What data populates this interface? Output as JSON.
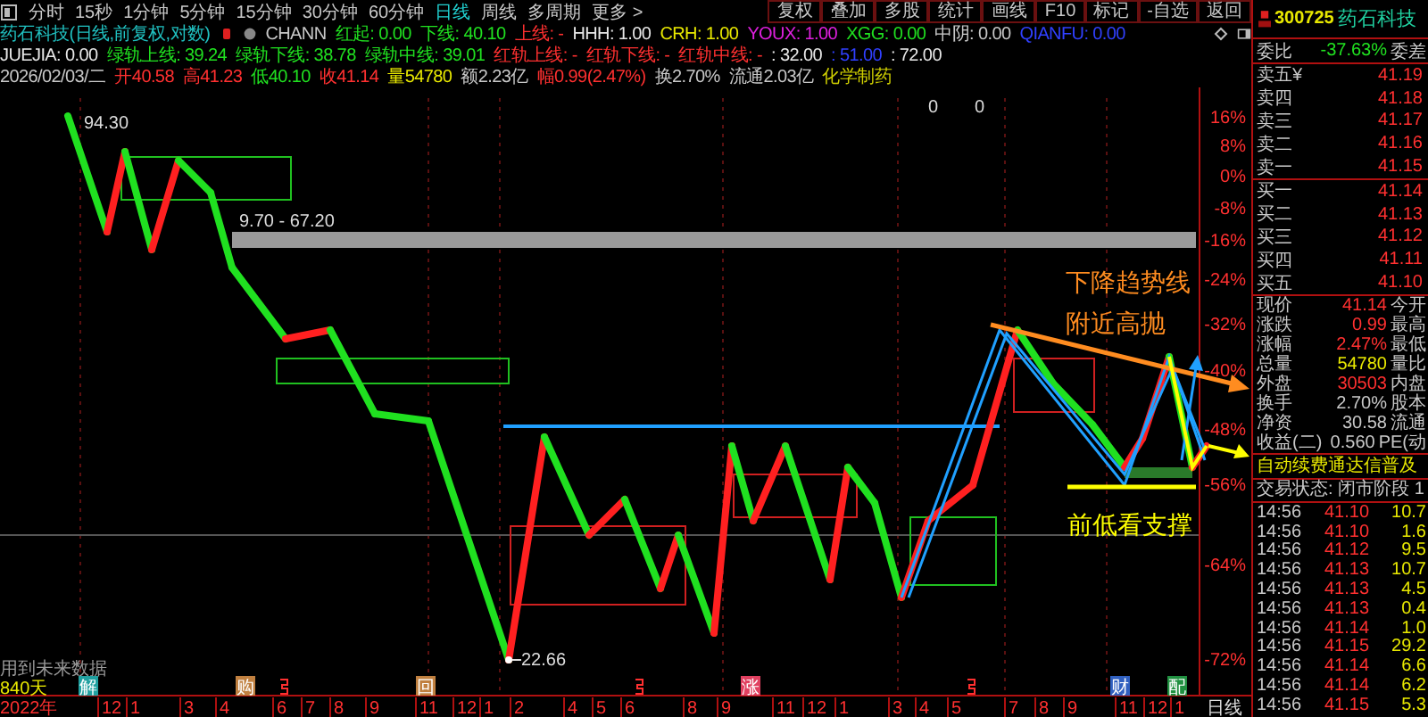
{
  "toolbar": {
    "tabs": [
      {
        "label": "分时",
        "selected": false
      },
      {
        "label": "15秒",
        "selected": false
      },
      {
        "label": "1分钟",
        "selected": false
      },
      {
        "label": "5分钟",
        "selected": false
      },
      {
        "label": "15分钟",
        "selected": false
      },
      {
        "label": "30分钟",
        "selected": false
      },
      {
        "label": "60分钟",
        "selected": false
      },
      {
        "label": "日线",
        "selected": true
      },
      {
        "label": "周线",
        "selected": false
      },
      {
        "label": "多周期",
        "selected": false
      },
      {
        "label": "更多 >",
        "selected": false
      }
    ],
    "buttons": [
      "复权",
      "叠加",
      "多股",
      "统计",
      "画线",
      "F10",
      "标记",
      "-自选",
      "返回"
    ]
  },
  "indicators": {
    "title": "药石科技(日线,前复权,对数)",
    "line1": [
      {
        "text": "CHANN",
        "color": "#c8c8c8"
      },
      {
        "text": "红起: 0.00",
        "color": "#20e020"
      },
      {
        "text": "下线: 40.10",
        "color": "#20e020"
      },
      {
        "text": "上线: -",
        "color": "#ff3030"
      },
      {
        "text": "HHH: 1.00",
        "color": "#e8e8e8"
      },
      {
        "text": "CRH: 1.00",
        "color": "#e8e800"
      },
      {
        "text": "YOUX: 1.00",
        "color": "#e020e0"
      },
      {
        "text": "XGG: 0.00",
        "color": "#20e020"
      },
      {
        "text": "中阴: 0.00",
        "color": "#c8c8c8"
      },
      {
        "text": "QIANFU: 0.00",
        "color": "#3040ff"
      }
    ],
    "line2": [
      {
        "text": "JUEJIA: 0.00",
        "color": "#e8e8e8"
      },
      {
        "text": "绿轨上线: 39.24",
        "color": "#20e020"
      },
      {
        "text": "绿轨下线: 38.78",
        "color": "#20e020"
      },
      {
        "text": "绿轨中线: 39.01",
        "color": "#20e020"
      },
      {
        "text": "红轨上线: -",
        "color": "#ff3030"
      },
      {
        "text": "红轨下线: -",
        "color": "#ff3030"
      },
      {
        "text": "红轨中线: -",
        "color": "#ff3030"
      },
      {
        "text": ": 32.00",
        "color": "#e8e8e8"
      },
      {
        "text": ": 51.00",
        "color": "#3040ff"
      },
      {
        "text": ": 72.00",
        "color": "#e8e8e8"
      }
    ],
    "line3": [
      {
        "text": "2026/02/03/二",
        "color": "#c8c8c8"
      },
      {
        "text": "开40.58",
        "color": "#ff3030"
      },
      {
        "text": "高41.23",
        "color": "#ff3030"
      },
      {
        "text": "低40.10",
        "color": "#20e020"
      },
      {
        "text": "收41.14",
        "color": "#ff3030"
      },
      {
        "text": "量54780",
        "color": "#e8e800"
      },
      {
        "text": "额2.23亿",
        "color": "#c8c8c8"
      },
      {
        "text": "幅0.99(2.47%)",
        "color": "#ff3030"
      },
      {
        "text": "换2.70%",
        "color": "#c8c8c8"
      },
      {
        "text": "流通2.03亿",
        "color": "#c8c8c8"
      },
      {
        "text": "化学制药",
        "color": "#d0d000"
      }
    ]
  },
  "chart": {
    "price_labels": [
      "94.30",
      "9.70 - 67.20",
      "22.66",
      "0",
      "0"
    ],
    "y_axis": [
      "16%",
      "8%",
      "0%",
      "-8%",
      "-16%",
      "-24%",
      "-32%",
      "-40%",
      "-48%",
      "-56%",
      "-64%",
      "-72%"
    ],
    "annotations": [
      {
        "text": "下降趋势线",
        "color": "#ff8c20"
      },
      {
        "text": "附近高抛",
        "color": "#ff8c20"
      },
      {
        "text": "前低看支撑",
        "color": "#ffff00"
      }
    ],
    "notes": [
      "用到未来数据",
      "840天"
    ],
    "events": [
      {
        "label": "解",
        "color": "#20a0a0"
      },
      {
        "label": "购",
        "color": "#c08040"
      },
      {
        "label": "回",
        "color": "#c08040"
      },
      {
        "label": "涨",
        "color": "#e04060"
      },
      {
        "label": "财",
        "color": "#3060c0"
      },
      {
        "label": "配",
        "color": "#209040"
      }
    ],
    "x_axis": [
      "2022年",
      "12",
      "1",
      "3",
      "4",
      "6",
      "7",
      "8",
      "9",
      "11",
      "12",
      "1",
      "2",
      "4",
      "5",
      "6",
      "8",
      "9",
      "11",
      "12",
      "1",
      "3",
      "4",
      "5",
      "7",
      "8",
      "9",
      "11",
      "12",
      "1"
    ],
    "period": "日线"
  },
  "quote": {
    "code": "300725",
    "name": "药石科技",
    "weibi": {
      "label": "委比",
      "value": "-37.63%",
      "right": "委差"
    },
    "sells": [
      {
        "label": "卖五¥",
        "price": "41.19"
      },
      {
        "label": "卖四",
        "price": "41.18"
      },
      {
        "label": "卖三",
        "price": "41.17"
      },
      {
        "label": "卖二",
        "price": "41.16"
      },
      {
        "label": "卖一",
        "price": "41.15"
      }
    ],
    "buys": [
      {
        "label": "买一",
        "price": "41.14"
      },
      {
        "label": "买二",
        "price": "41.13"
      },
      {
        "label": "买三",
        "price": "41.12"
      },
      {
        "label": "买四",
        "price": "41.11"
      },
      {
        "label": "买五",
        "price": "41.10"
      }
    ],
    "stats": [
      {
        "label": "现价",
        "value": "41.14",
        "color": "#ff3030",
        "right": "今开"
      },
      {
        "label": "涨跌",
        "value": "0.99",
        "color": "#ff3030",
        "right": "最高"
      },
      {
        "label": "涨幅",
        "value": "2.47%",
        "color": "#ff3030",
        "right": "最低"
      },
      {
        "label": "总量",
        "value": "54780",
        "color": "#e8e800",
        "right": "量比"
      },
      {
        "label": "外盘",
        "value": "30503",
        "color": "#ff3030",
        "right": "内盘"
      },
      {
        "label": "换手",
        "value": "2.70%",
        "color": "#c8c8c8",
        "right": "股本"
      },
      {
        "label": "净资",
        "value": "30.58",
        "color": "#c8c8c8",
        "right": "流通"
      },
      {
        "label": "收益(二)",
        "value": "0.560",
        "color": "#c8c8c8",
        "right": "PE(动"
      }
    ],
    "banner": "自动续费通达信普及",
    "status": "交易状态: 闭市阶段 1",
    "ticks": [
      {
        "time": "14:56",
        "price": "41.10",
        "volume": "10.7"
      },
      {
        "time": "14:56",
        "price": "41.10",
        "volume": "1.6"
      },
      {
        "time": "14:56",
        "price": "41.12",
        "volume": "9.5"
      },
      {
        "time": "14:56",
        "price": "41.13",
        "volume": "10.7"
      },
      {
        "time": "14:56",
        "price": "41.13",
        "volume": "4.5"
      },
      {
        "time": "14:56",
        "price": "41.13",
        "volume": "0.4"
      },
      {
        "time": "14:56",
        "price": "41.14",
        "volume": "1.0"
      },
      {
        "time": "14:56",
        "price": "41.15",
        "volume": "29.2"
      },
      {
        "time": "14:56",
        "price": "41.14",
        "volume": "6.6"
      },
      {
        "time": "14:56",
        "price": "41.14",
        "volume": "6.2"
      },
      {
        "time": "14:56",
        "price": "41.15",
        "volume": "5.3"
      }
    ]
  }
}
